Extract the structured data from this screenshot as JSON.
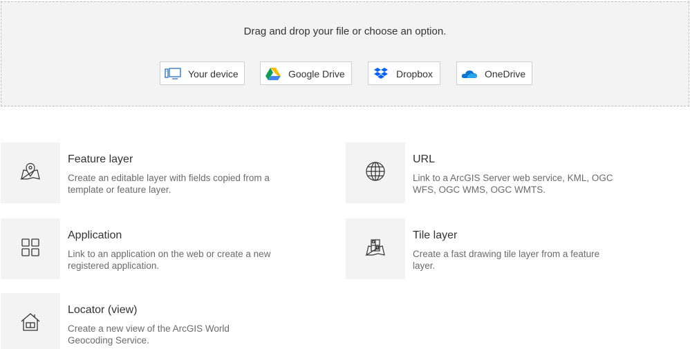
{
  "dropzone": {
    "prompt": "Drag and drop your file or choose an option.",
    "sources": [
      {
        "label": "Your device",
        "icon": "device-icon"
      },
      {
        "label": "Google Drive",
        "icon": "google-drive-icon"
      },
      {
        "label": "Dropbox",
        "icon": "dropbox-icon"
      },
      {
        "label": "OneDrive",
        "icon": "onedrive-icon"
      }
    ]
  },
  "options": [
    {
      "title": "Feature layer",
      "description": "Create an editable layer with fields copied from a template or feature layer.",
      "icon": "map-pin-icon"
    },
    {
      "title": "URL",
      "description": "Link to a ArcGIS Server web service, KML, OGC WFS, OGC WMS, OGC WMTS.",
      "icon": "globe-icon"
    },
    {
      "title": "Application",
      "description": "Link to an application on the web or create a new registered application.",
      "icon": "grid-icon"
    },
    {
      "title": "Tile layer",
      "description": "Create a fast drawing tile layer from a feature layer.",
      "icon": "tile-layer-icon"
    },
    {
      "title": "Locator (view)",
      "description": "Create a new view of the ArcGIS World Geocoding Service.",
      "icon": "house-icon"
    }
  ]
}
